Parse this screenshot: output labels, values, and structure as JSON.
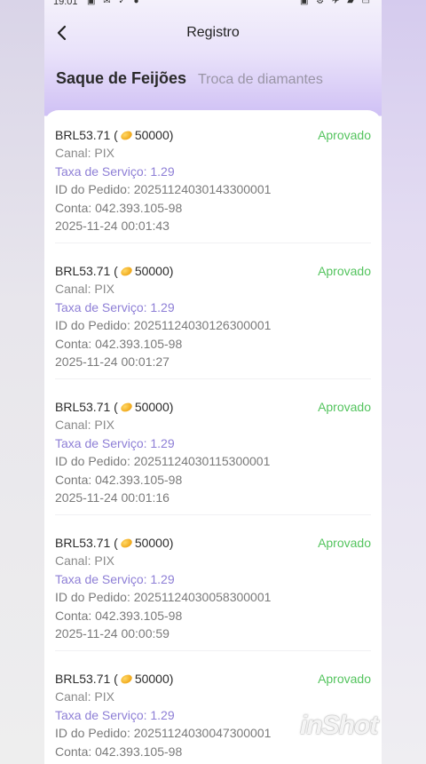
{
  "statusbar": {
    "time": "19:01",
    "left_icons": "▣ ✉ ✓ ●",
    "right_icons": "▣ ⚙ ✈ ▰ ▭"
  },
  "header": {
    "title": "Registro"
  },
  "tabs": [
    {
      "label": "Saque de Feijões",
      "active": true
    },
    {
      "label": "Troca de diamantes",
      "active": false
    }
  ],
  "records": [
    {
      "amount": "BRL53.71 (",
      "beans": "50000)",
      "status": "Aprovado",
      "channel": "Canal: PIX",
      "fee": "Taxa de Serviço: 1.29",
      "order": "ID do Pedido: 20251124030143300001",
      "account": "Conta: 042.393.105-98",
      "datetime": "2025-11-24 00:01:43"
    },
    {
      "amount": "BRL53.71 (",
      "beans": "50000)",
      "status": "Aprovado",
      "channel": "Canal: PIX",
      "fee": "Taxa de Serviço: 1.29",
      "order": "ID do Pedido: 20251124030126300001",
      "account": "Conta: 042.393.105-98",
      "datetime": "2025-11-24 00:01:27"
    },
    {
      "amount": "BRL53.71 (",
      "beans": "50000)",
      "status": "Aprovado",
      "channel": "Canal: PIX",
      "fee": "Taxa de Serviço: 1.29",
      "order": "ID do Pedido: 20251124030115300001",
      "account": "Conta: 042.393.105-98",
      "datetime": "2025-11-24 00:01:16"
    },
    {
      "amount": "BRL53.71 (",
      "beans": "50000)",
      "status": "Aprovado",
      "channel": "Canal: PIX",
      "fee": "Taxa de Serviço: 1.29",
      "order": "ID do Pedido: 20251124030058300001",
      "account": "Conta: 042.393.105-98",
      "datetime": "2025-11-24 00:00:59"
    },
    {
      "amount": "BRL53.71 (",
      "beans": "50000)",
      "status": "Aprovado",
      "channel": "Canal: PIX",
      "fee": "Taxa de Serviço: 1.29",
      "order": "ID do Pedido: 20251124030047300001",
      "account": "Conta: 042.393.105-98",
      "datetime": ""
    }
  ],
  "watermark": "inShot",
  "icons": {
    "back": "chevron-left-icon",
    "bean": "bean-coin-icon"
  },
  "colors": {
    "approved": "#54c45e",
    "fee": "#8e7fd6",
    "header_gradient": "#cfc1f5"
  }
}
